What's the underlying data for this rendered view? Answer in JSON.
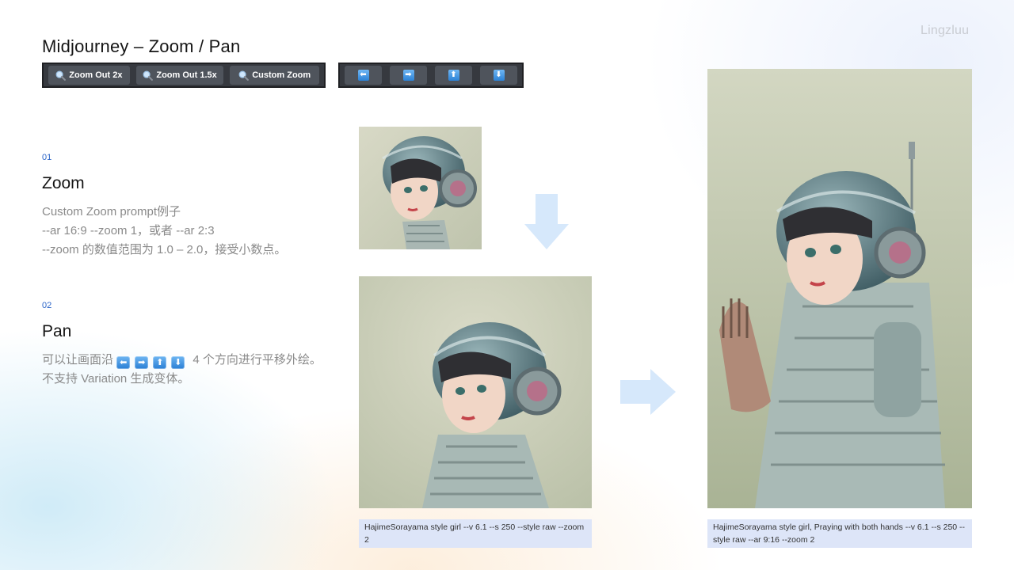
{
  "brand": "Lingzluu",
  "page_title": "Midjourney – Zoom / Pan",
  "zoom_buttons": [
    {
      "label": "Zoom Out 2x",
      "icon": "magnifier-icon"
    },
    {
      "label": "Zoom Out 1.5x",
      "icon": "magnifier-icon"
    },
    {
      "label": "Custom Zoom",
      "icon": "magnifier-icon"
    }
  ],
  "pan_buttons": [
    {
      "icon": "arrow-left-icon",
      "glyph": "⬅"
    },
    {
      "icon": "arrow-right-icon",
      "glyph": "➡"
    },
    {
      "icon": "arrow-up-icon",
      "glyph": "⬆"
    },
    {
      "icon": "arrow-down-icon",
      "glyph": "⬇"
    }
  ],
  "sections": {
    "zoom": {
      "number": "01",
      "title": "Zoom",
      "lines": [
        "Custom Zoom prompt例子",
        "--ar 16:9 --zoom 1，或者 --ar 2:3",
        "--zoom 的数值范围为 1.0 – 2.0，接受小数点。"
      ]
    },
    "pan": {
      "number": "02",
      "title": "Pan",
      "line1_prefix": "可以让画面沿",
      "line1_suffix": "4 个方向进行平移外绘。",
      "line2": "不支持 Variation 生成变体。"
    }
  },
  "captions": {
    "zoom_example": "HajimeSorayama style girl --v 6.1 --s 250 --style raw --zoom 2",
    "tall_example": "HajimeSorayama style girl, Praying with both hands --v 6.1 --s 250 --style raw --ar 9:16 --zoom 2"
  },
  "colors": {
    "accent": "#2a64c8",
    "discord_bar": "#36393f",
    "discord_button": "#4f545c",
    "caption_bg": "#dde5f8",
    "flow_arrow": "#d6e8fb"
  }
}
